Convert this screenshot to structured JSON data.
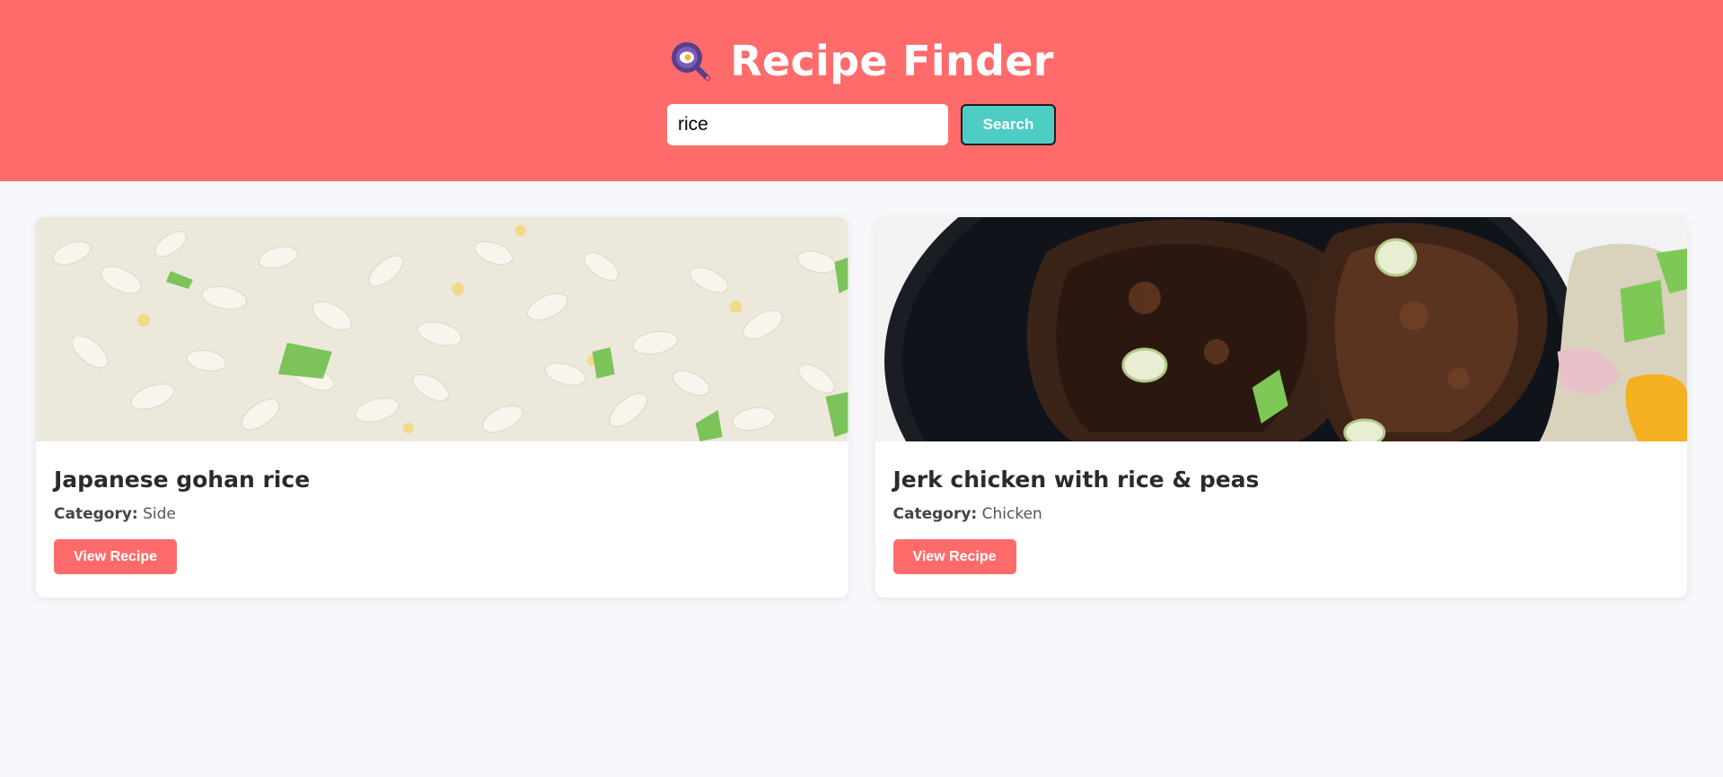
{
  "app": {
    "title": "Recipe Finder",
    "logo_icon": "magnifier-with-egg-icon"
  },
  "search": {
    "value": "rice",
    "button_label": "Search"
  },
  "recipes": [
    {
      "name": "Japanese gohan rice",
      "category_label": "Category:",
      "category": "Side",
      "button_label": "View Recipe",
      "image": "fried-rice-photo"
    },
    {
      "name": "Jerk chicken with rice & peas",
      "category_label": "Category:",
      "category": "Chicken",
      "button_label": "View Recipe",
      "image": "jerk-chicken-photo"
    }
  ],
  "colors": {
    "header": "#ff6b6b",
    "search_button": "#4ecdc4",
    "view_button": "#ff6b6b",
    "background": "#f7f8fb"
  }
}
